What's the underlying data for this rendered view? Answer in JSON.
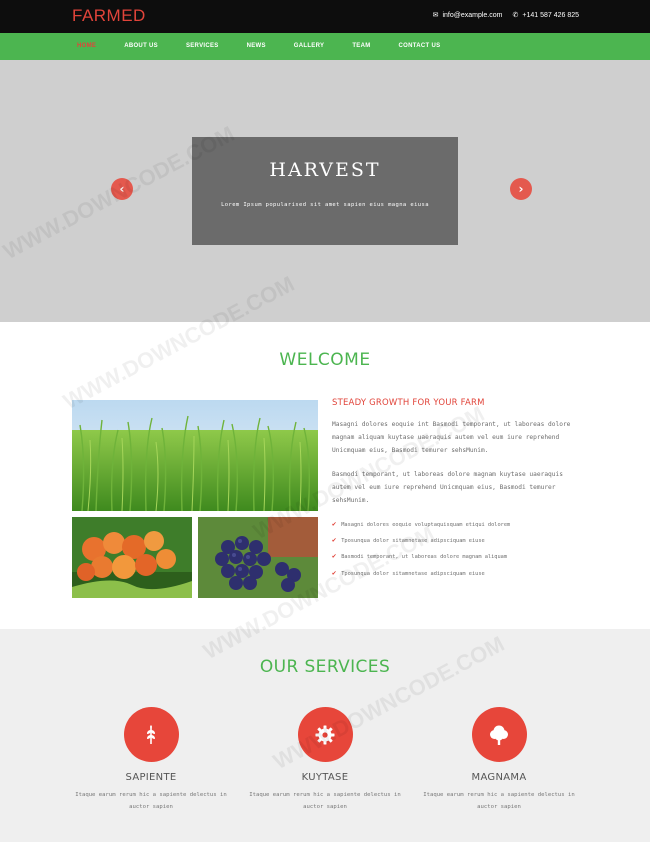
{
  "header": {
    "logo": "FARMED",
    "email": "info@example.com",
    "phone": "+141 587 426 825"
  },
  "nav": {
    "items": [
      {
        "label": "HOME",
        "active": true
      },
      {
        "label": "ABOUT US",
        "active": false
      },
      {
        "label": "SERVICES",
        "active": false
      },
      {
        "label": "NEWS",
        "active": false
      },
      {
        "label": "GALLERY",
        "active": false
      },
      {
        "label": "TEAM",
        "active": false
      },
      {
        "label": "CONTACT US",
        "active": false
      }
    ]
  },
  "hero": {
    "title": "HARVEST",
    "subtitle": "Lorem Ipsum popularised sit amet sapien eius magna eiusa",
    "prev_icon": "chevron-left-icon",
    "next_icon": "chevron-right-icon"
  },
  "welcome": {
    "title": "WELCOME",
    "subheading": "STEADY GROWTH FOR YOUR FARM",
    "paragraph1": "Masagni dolores eoquie int Basmodi temporant, ut laboreas dolore magnam aliquam kuytase uaeraquis autem vel eum iure reprehend Unicmquam eius, Basmodi temurer sehsMunim.",
    "paragraph2": "Basmodi temporant, ut laboreas dolore magnam kuytase uaeraquis autem vel eum iure reprehend Unicmquam eius, Basmodi temurer sehsMunim.",
    "checklist": [
      "Masagni dolores eoquie voluptaquisquam etiqui dolorem",
      "Tposunqua dolor sitamnetase adipsciquam eiuse",
      "Basmodi temporant, ut laboreas dolore magnam aliquam",
      "Tposunqua dolor sitamnetase adipsciquam eiuse"
    ]
  },
  "services": {
    "title": "OUR SERVICES",
    "items": [
      {
        "name": "SAPIENTE",
        "icon": "wheat-icon",
        "desc": "Itaque earum rerum hic a sapiente delectus in auctor sapien"
      },
      {
        "name": "KUYTASE",
        "icon": "gear-icon",
        "desc": "Itaque earum rerum hic a sapiente delectus in auctor sapien"
      },
      {
        "name": "MAGNAMA",
        "icon": "tree-icon",
        "desc": "Itaque earum rerum hic a sapiente delectus in auctor sapien"
      }
    ]
  },
  "watermark": "WWW.DOWNCODE.COM",
  "colors": {
    "accent_red": "#e1443a",
    "accent_green": "#4cb550",
    "topbar": "#0d0d0d"
  }
}
